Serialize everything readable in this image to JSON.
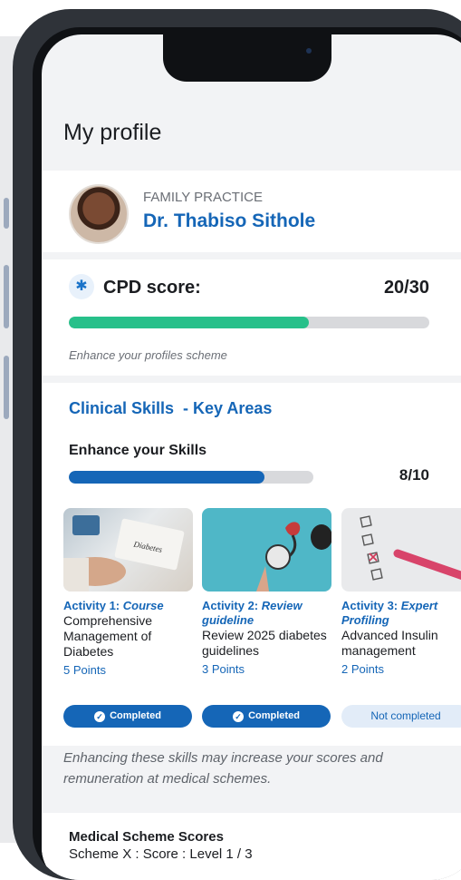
{
  "page": {
    "title": "My profile"
  },
  "profile": {
    "practice": "FAMILY PRACTICE",
    "name": "Dr. Thabiso Sithole"
  },
  "cpd": {
    "label": "CPD score:",
    "value": "20/30",
    "progress": 0.667,
    "hint": "Enhance your profiles scheme",
    "icon": "caduceus-icon"
  },
  "skills": {
    "title": "Clinical Skills  - Key Areas",
    "subtitle": "Enhance your Skills",
    "value": "8/10",
    "progress": 0.8,
    "activities": [
      {
        "label": "Activity 1:",
        "type": "Course",
        "description": "Comprehensive Management of Diabetes",
        "points": "5 Points",
        "status": "Completed",
        "image": "diabetes-notebook-image"
      },
      {
        "label": "Activity 2:",
        "type": "Review guideline",
        "description": "Review 2025 diabetes guidelines",
        "points": "3 Points",
        "status": "Completed",
        "image": "stethoscope-image"
      },
      {
        "label": "Activity 3:",
        "type": "Expert Profiling",
        "description": "Advanced Insulin management",
        "points": "2 Points",
        "status": "Not completed",
        "image": "checklist-image"
      }
    ],
    "note": "Enhancing these skills may increase your scores and remuneration at medical schemes."
  },
  "scheme": {
    "title": "Medical Scheme Scores",
    "line": "Scheme X  : Score : Level 1 / 3"
  },
  "colors": {
    "primary": "#1566b7",
    "success": "#27c08a",
    "background": "#f2f3f5",
    "frame": "#2f3339"
  }
}
